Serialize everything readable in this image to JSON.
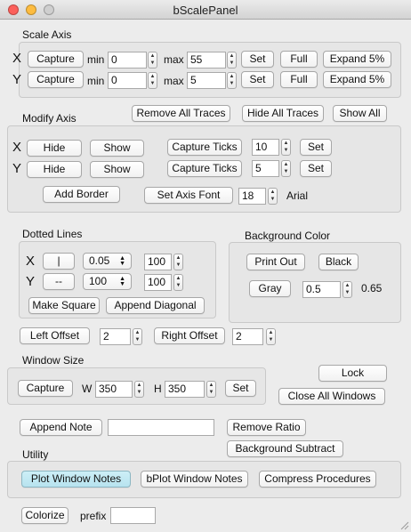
{
  "window": {
    "title": "bScalePanel"
  },
  "scale_axis": {
    "heading": "Scale Axis",
    "x": {
      "letter": "X",
      "capture": "Capture",
      "min_label": "min",
      "min_value": "0",
      "max_label": "max",
      "max_value": "55",
      "set": "Set",
      "full": "Full",
      "expand": "Expand 5%"
    },
    "y": {
      "letter": "Y",
      "capture": "Capture",
      "min_label": "min",
      "min_value": "0",
      "max_label": "max",
      "max_value": "5",
      "set": "Set",
      "full": "Full",
      "expand": "Expand 5%"
    }
  },
  "modify_axis": {
    "heading": "Modify Axis",
    "remove_all_traces": "Remove All Traces",
    "hide_all_traces": "Hide All Traces",
    "show_all": "Show All",
    "x": {
      "letter": "X",
      "hide": "Hide",
      "show": "Show",
      "capture_ticks": "Capture Ticks",
      "ticks_value": "10",
      "set": "Set"
    },
    "y": {
      "letter": "Y",
      "hide": "Hide",
      "show": "Show",
      "capture_ticks": "Capture Ticks",
      "ticks_value": "5",
      "set": "Set"
    },
    "add_border": "Add Border",
    "set_axis_font": "Set Axis Font",
    "font_size": "18",
    "font_name": "Arial"
  },
  "dotted_lines": {
    "heading": "Dotted Lines",
    "x": {
      "letter": "X",
      "style_button": "|",
      "popup_value": "0.05",
      "field_value": "100"
    },
    "y": {
      "letter": "Y",
      "style_button": "--",
      "popup_value": "100",
      "field_value": "100"
    },
    "make_square": "Make Square",
    "append_diagonal": "Append Diagonal"
  },
  "background_color": {
    "heading": "Background Color",
    "print_out": "Print Out",
    "black": "Black",
    "gray": "Gray",
    "gray_field": "0.5",
    "gray_readout": "0.65"
  },
  "offsets": {
    "left_label": "Left Offset",
    "left_value": "2",
    "right_label": "Right Offset",
    "right_value": "2"
  },
  "window_size": {
    "heading": "Window Size",
    "capture": "Capture",
    "w_label": "W",
    "w_value": "350",
    "h_label": "H",
    "h_value": "350",
    "set": "Set",
    "lock": "Lock",
    "close_all": "Close All Windows"
  },
  "notes": {
    "append_note": "Append Note",
    "note_field": "",
    "remove_ratio": "Remove Ratio",
    "background_subtract": "Background Subtract"
  },
  "utility": {
    "heading": "Utility",
    "plot_window_notes": "Plot Window Notes",
    "bplot_window_notes": "bPlot Window Notes",
    "compress_procedures": "Compress Procedures"
  },
  "bottom": {
    "colorize": "Colorize",
    "prefix_label": "prefix",
    "prefix_value": ""
  },
  "colors": {
    "active_button": "#b7e3ef",
    "close": "#fc605b",
    "minimize": "#fdbc40"
  }
}
